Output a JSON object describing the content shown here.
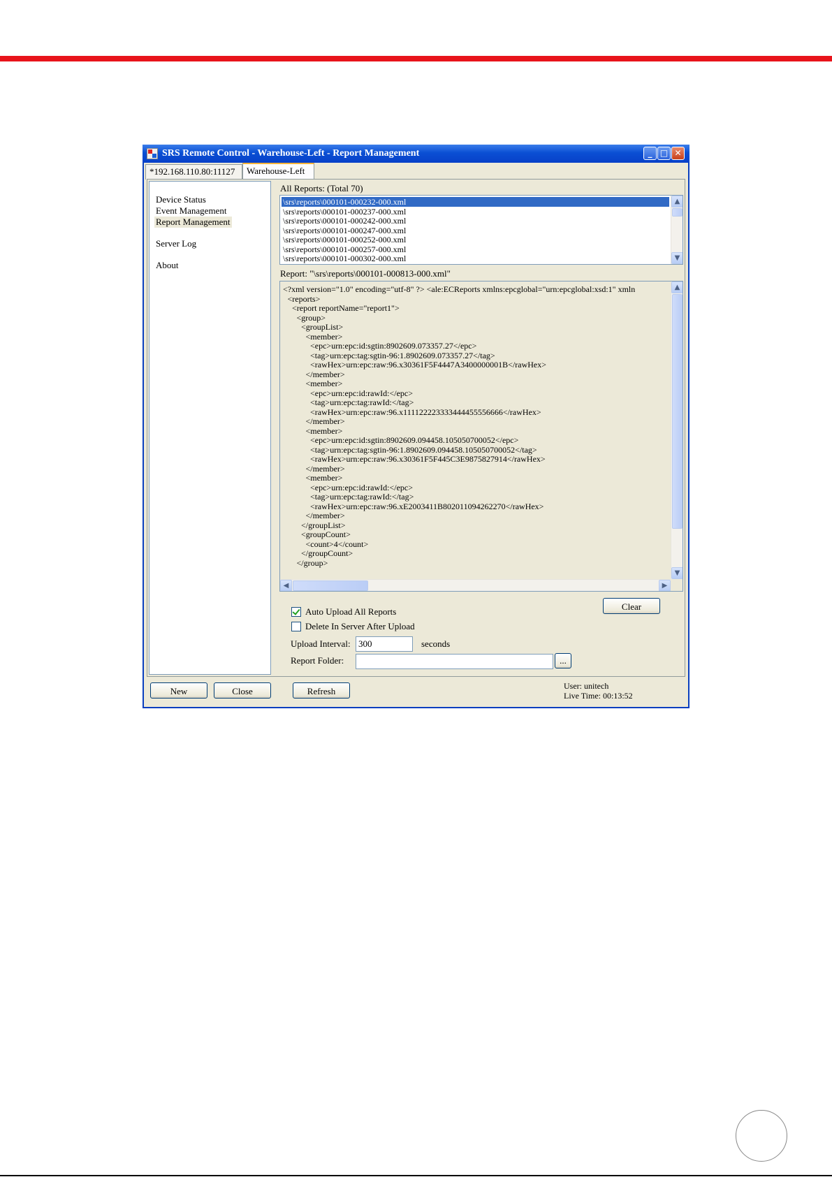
{
  "window": {
    "title": "SRS Remote Control - Warehouse-Left - Report Management"
  },
  "tabs": [
    {
      "label": "*192.168.110.80:11127"
    },
    {
      "label": "Warehouse-Left"
    }
  ],
  "nav": {
    "items": [
      {
        "label": "Device Status"
      },
      {
        "label": "Event Management"
      },
      {
        "label": "Report Management"
      },
      {
        "label": "Server Log"
      },
      {
        "label": "About"
      }
    ],
    "active": "Report Management"
  },
  "reports": {
    "header": "All Reports: (Total 70)",
    "items": [
      "\\srs\\reports\\000101-000232-000.xml",
      "\\srs\\reports\\000101-000237-000.xml",
      "\\srs\\reports\\000101-000242-000.xml",
      "\\srs\\reports\\000101-000247-000.xml",
      "\\srs\\reports\\000101-000252-000.xml",
      "\\srs\\reports\\000101-000257-000.xml",
      "\\srs\\reports\\000101-000302-000.xml"
    ],
    "selected": "\\srs\\reports\\000101-000232-000.xml"
  },
  "report": {
    "header": "Report: \"\\srs\\reports\\000101-000813-000.xml\"",
    "lines": [
      "<?xml version=\"1.0\" encoding=\"utf-8\" ?> <ale:ECReports xmlns:epcglobal=\"urn:epcglobal:xsd:1\" xmln",
      "<reports>",
      "<report reportName=\"report1\">",
      "<group>",
      "<groupList>",
      "<member>",
      "<epc>urn:epc:id:sgtin:8902609.073357.27</epc>",
      "<tag>urn:epc:tag:sgtin-96:1.8902609.073357.27</tag>",
      "<rawHex>urn:epc:raw:96.x30361F5F4447A3400000001B</rawHex>",
      "</member>",
      "<member>",
      "<epc>urn:epc:id:rawId:</epc>",
      "<tag>urn:epc:tag:rawId:</tag>",
      "<rawHex>urn:epc:raw:96.x111122223333444455556666</rawHex>",
      "</member>",
      "<member>",
      "<epc>urn:epc:id:sgtin:8902609.094458.105050700052</epc>",
      "<tag>urn:epc:tag:sgtin-96:1.8902609.094458.105050700052</tag>",
      "<rawHex>urn:epc:raw:96.x30361F5F445C3E9875827914</rawHex>",
      "</member>",
      "<member>",
      "<epc>urn:epc:id:rawId:</epc>",
      "<tag>urn:epc:tag:rawId:</tag>",
      "<rawHex>urn:epc:raw:96.xE2003411B802011094262270</rawHex>",
      "</member>",
      "</groupList>",
      "<groupCount>",
      "<count>4</count>",
      "</groupCount>",
      "</group>"
    ],
    "indent": [
      0,
      1,
      2,
      3,
      4,
      5,
      6,
      6,
      6,
      5,
      5,
      6,
      6,
      6,
      5,
      5,
      6,
      6,
      6,
      5,
      5,
      6,
      6,
      6,
      5,
      4,
      4,
      5,
      4,
      3
    ]
  },
  "settings": {
    "clear_label": "Clear",
    "auto_upload_label": "Auto Upload All Reports",
    "auto_upload_checked": true,
    "delete_after_label": "Delete In Server After Upload",
    "delete_after_checked": false,
    "upload_interval_label": "Upload Interval:",
    "upload_interval_value": "300",
    "seconds_label": "seconds",
    "report_folder_label": "Report Folder:",
    "report_folder_value": "",
    "browse_label": "..."
  },
  "footer": {
    "new_label": "New",
    "close_label": "Close",
    "refresh_label": "Refresh",
    "user_text": "User: unitech",
    "live_time_text": "Live Time: 00:13:52"
  },
  "colors": {
    "rule_red": "#e8141b",
    "titlebar_blue": "#0a4fd4",
    "selection_blue": "#316ac5",
    "window_bg": "#ece9d8"
  }
}
